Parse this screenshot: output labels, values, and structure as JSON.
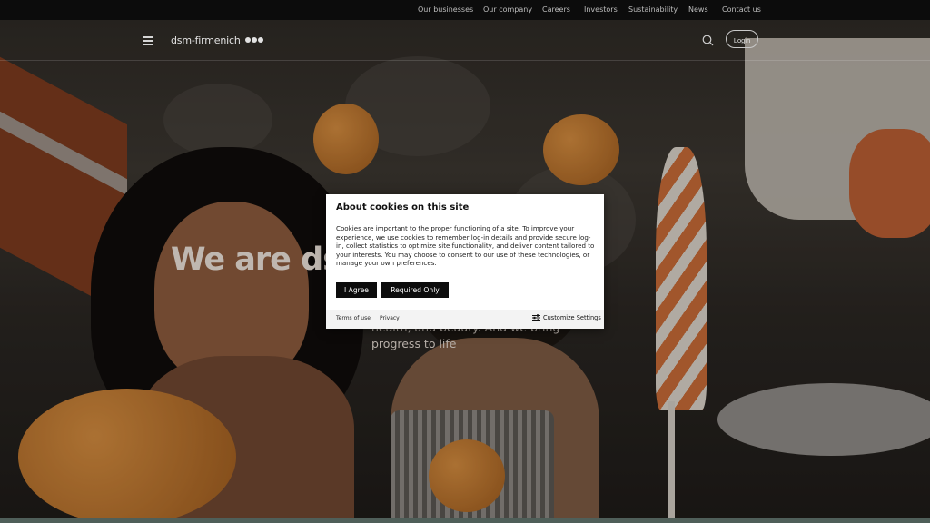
{
  "top_nav": {
    "links": [
      "Our businesses",
      "Our company",
      "Careers",
      "Investors",
      "Sustainability",
      "News",
      "Contact us"
    ]
  },
  "header": {
    "logo_text": "dsm-firmenich",
    "login_label": "Login",
    "icons": [
      "menu-icon",
      "search-icon"
    ]
  },
  "hero": {
    "title": "We are ds",
    "subtitle": "health, and beauty. And we bring progress to life"
  },
  "cookie_dialog": {
    "title": "About cookies on this site",
    "body": "Cookies are important to the proper functioning of a site. To improve your experience, we use cookies to remember log-in details and provide secure log-in, collect statistics to optimize site functionality, and deliver content tailored to your interests. You may choose to consent to our use of these technologies, or manage your own preferences.",
    "agree_label": "I Agree",
    "required_label": "Required Only",
    "terms_label": "Terms of use",
    "privacy_label": "Privacy",
    "customize_label": "Customize Settings"
  },
  "colors": {
    "topbar_bg": "#0c0c0c",
    "button_bg": "#0c0c0c",
    "accent_orange": "#c56a36"
  }
}
